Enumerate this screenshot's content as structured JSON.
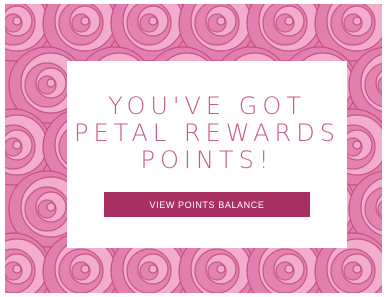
{
  "promo": {
    "headline_lines": [
      "YOU'VE GOT",
      "PETAL REWARDS",
      "POINTS!"
    ],
    "cta_label": "VIEW POINTS BALANCE"
  },
  "colors": {
    "background_roses": "#e37fae",
    "rose_dark": "#c24f84",
    "rose_light": "#f4b2d0",
    "headline": "#c9578b",
    "cta_background": "#a82f61",
    "cta_text": "#ffffff",
    "card": "#ffffff"
  },
  "background": {
    "image": "pink-roses-photo"
  }
}
